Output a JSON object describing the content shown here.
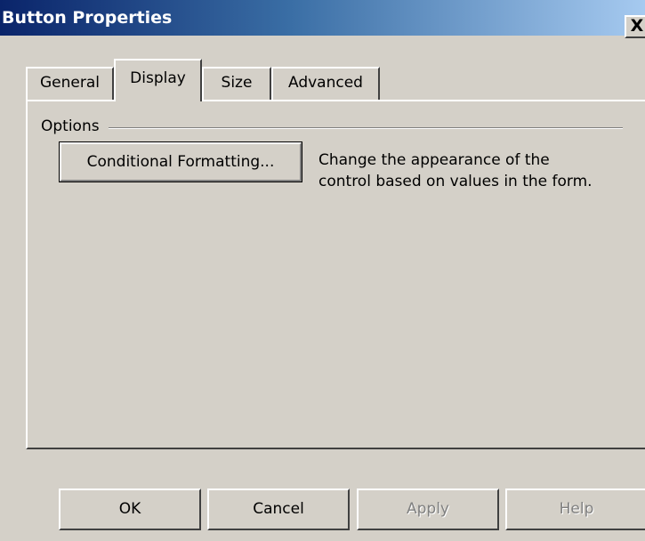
{
  "window": {
    "title": "Button Properties",
    "close_symbol": "X",
    "close_icon": "close-icon"
  },
  "tabs": [
    {
      "label": "General",
      "active": false
    },
    {
      "label": "Display",
      "active": true
    },
    {
      "label": "Size",
      "active": false
    },
    {
      "label": "Advanced",
      "active": false
    }
  ],
  "options": {
    "group_label": "Options",
    "conditional_formatting_label": "Conditional Formatting...",
    "description": "Change the appearance of the control based on values in the form."
  },
  "buttons": {
    "ok": "OK",
    "cancel": "Cancel",
    "apply": "Apply",
    "help": "Help"
  },
  "colors": {
    "titlebar_start": "#0a246a",
    "titlebar_end": "#a6caf0",
    "face": "#d4d0c8",
    "disabled_text": "#808080"
  }
}
